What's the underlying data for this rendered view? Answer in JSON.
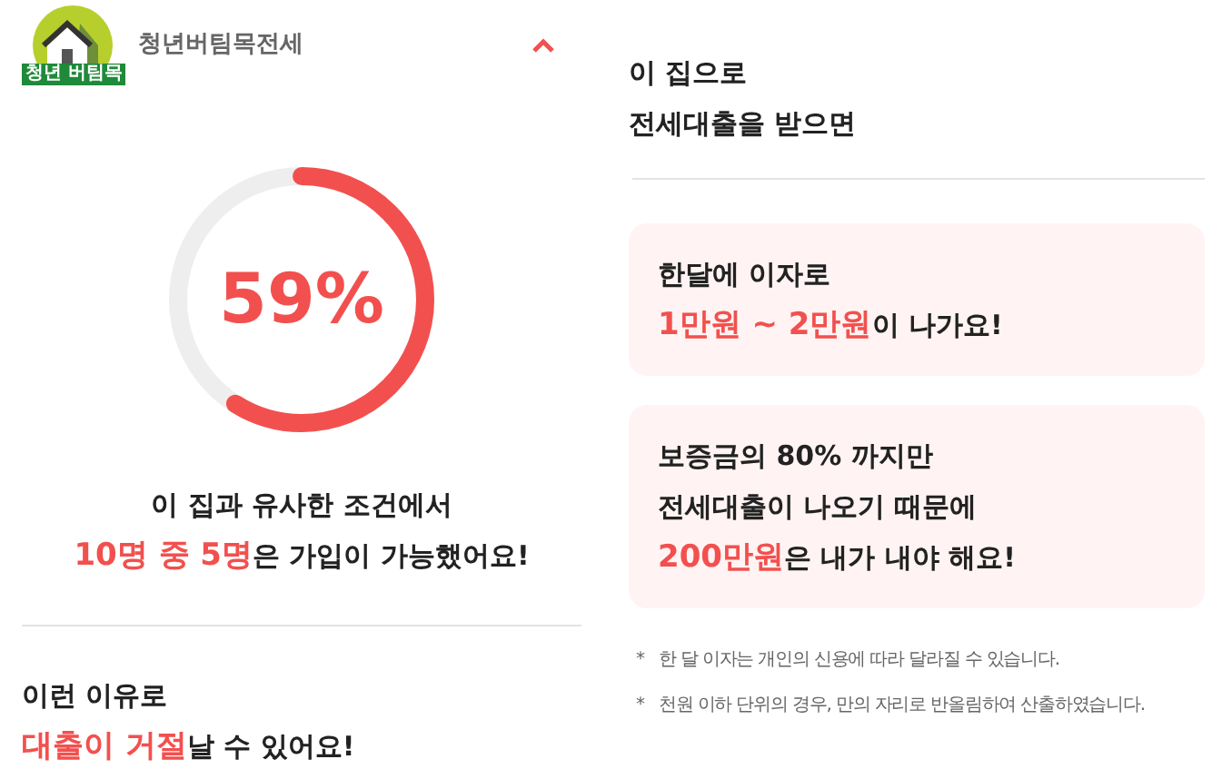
{
  "product": {
    "logo_text": "청년 버팀목",
    "title": "청년버팀목전세",
    "expanded": true
  },
  "approval": {
    "percent": "59%",
    "lines": [
      "이 집과 유사한 조건에서",
      "**10명 중 5명**은 가입이 가능했어요!"
    ]
  },
  "rejection": {
    "lines": [
      "이런 이유로",
      "**대출이 거절**날 수 있어요!"
    ]
  },
  "summary": {
    "lines": [
      "이 집으로",
      "전세대출을 받으면"
    ]
  },
  "cards": [
    {
      "lines": [
        "한달에 이자로",
        "**1만원 ~ 2만원**이 나가요!"
      ]
    },
    {
      "lines": [
        "보증금의 80% 까지만",
        "전세대출이 나오기 때문에",
        "**200만원**은 내가 내야 해요!"
      ]
    }
  ],
  "footnotes": [
    {
      "mark": "*",
      "text": "한 달 이자는 개인의 신용에 따라 달라질 수 있습니다."
    },
    {
      "mark": "*",
      "text": "천원 이하 단위의 경우, 만의 자리로 반올림하여 산출하였습니다."
    }
  ]
}
